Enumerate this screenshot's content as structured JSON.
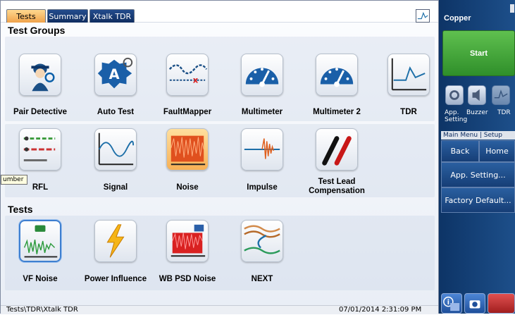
{
  "tabs": [
    {
      "label": "Tests",
      "active": true
    },
    {
      "label": "Summary",
      "active": false
    },
    {
      "label": "Xtalk TDR",
      "active": false
    }
  ],
  "sections": {
    "test_groups": "Test Groups",
    "tests": "Tests"
  },
  "test_groups": [
    {
      "label": "Pair Detective",
      "icon": "pair-detective-icon"
    },
    {
      "label": "Auto Test",
      "icon": "auto-test-icon"
    },
    {
      "label": "FaultMapper",
      "icon": "faultmapper-icon"
    },
    {
      "label": "Multimeter",
      "icon": "multimeter-icon"
    },
    {
      "label": "Multimeter 2",
      "icon": "multimeter2-icon"
    },
    {
      "label": "TDR",
      "icon": "tdr-icon"
    },
    {
      "label": "RFL",
      "icon": "rfl-icon"
    },
    {
      "label": "Signal",
      "icon": "signal-icon"
    },
    {
      "label": "Noise",
      "icon": "noise-icon"
    },
    {
      "label": "Impulse",
      "icon": "impulse-icon"
    },
    {
      "label": "Test Lead\nCompensation",
      "icon": "test-lead-icon"
    }
  ],
  "tests": [
    {
      "label": "VF Noise",
      "icon": "vf-noise-icon"
    },
    {
      "label": "Power Influence",
      "icon": "power-influence-icon"
    },
    {
      "label": "WB PSD Noise",
      "icon": "wb-psd-noise-icon"
    },
    {
      "label": "NEXT",
      "icon": "next-icon"
    }
  ],
  "tooltip": "umber",
  "status": {
    "path": "Tests\\TDR\\Xtalk TDR",
    "datetime": "07/01/2014 2:31:09 PM"
  },
  "side": {
    "title": "Copper",
    "start": "Start",
    "app_setting": "App.\nSetting",
    "buzzer": "Buzzer",
    "tdr": "TDR",
    "menu_tabs": "Main Menu | Setup",
    "back": "Back",
    "home": "Home",
    "app_setting_btn": "App. Setting...",
    "factory_default": "Factory Default..."
  },
  "colors": {
    "accent": "#1d4f8a",
    "start": "#3fa535",
    "tab_active": "#f0a24a"
  }
}
